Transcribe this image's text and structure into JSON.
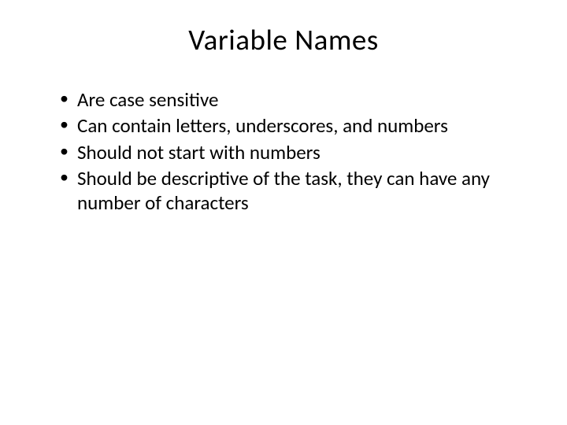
{
  "slide": {
    "title": "Variable Names",
    "bullets": [
      "Are case sensitive",
      "Can contain letters, underscores, and numbers",
      "Should not start with numbers",
      "Should be descriptive of the task, they can have any number of characters"
    ]
  }
}
